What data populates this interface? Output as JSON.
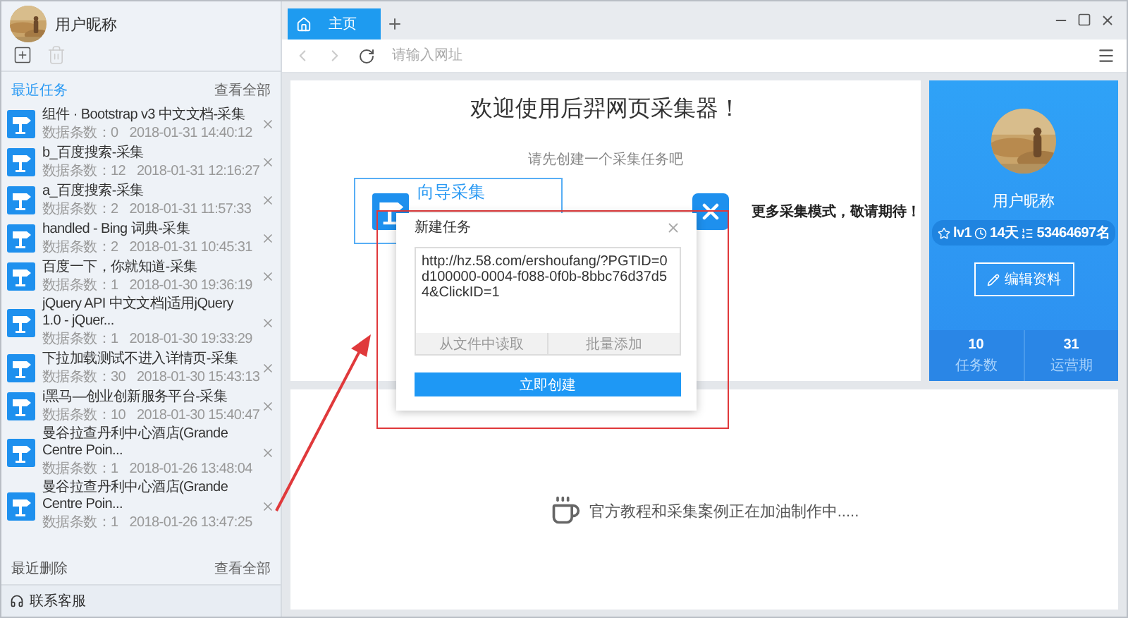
{
  "user": {
    "nickname": "用户昵称"
  },
  "sidebar": {
    "recent_title": "最近任务",
    "recent_link": "查看全部",
    "tasks": [
      {
        "title": "组件 · Bootstrap v3 中文文档-采集",
        "count": "数据条数：0",
        "time": "2018-01-31 14:40:12"
      },
      {
        "title": "b_百度搜索-采集",
        "count": "数据条数：12",
        "time": "2018-01-31 12:16:27"
      },
      {
        "title": "a_百度搜索-采集",
        "count": "数据条数：2",
        "time": "2018-01-31 11:57:33"
      },
      {
        "title": "handled - Bing 词典-采集",
        "count": "数据条数：2",
        "time": "2018-01-31 10:45:31"
      },
      {
        "title": "百度一下，你就知道-采集",
        "count": "数据条数：1",
        "time": "2018-01-30 19:36:19"
      },
      {
        "title": "jQuery API 中文文档|适用jQuery 1.0 - jQuer...",
        "count": "数据条数：1",
        "time": "2018-01-30 19:33:29"
      },
      {
        "title": "下拉加载测试不进入详情页-采集",
        "count": "数据条数：30",
        "time": "2018-01-30 15:43:13"
      },
      {
        "title": "i黑马—创业创新服务平台-采集",
        "count": "数据条数：10",
        "time": "2018-01-30 15:40:47"
      },
      {
        "title": "曼谷拉查丹利中心酒店(Grande Centre Poin...",
        "count": "数据条数：1",
        "time": "2018-01-26 13:48:04"
      },
      {
        "title": "曼谷拉查丹利中心酒店(Grande Centre Poin...",
        "count": "数据条数：1",
        "time": "2018-01-26 13:47:25"
      }
    ],
    "deleted_title": "最近删除",
    "deleted_link": "查看全部",
    "support": "联系客服"
  },
  "tabs": [
    {
      "label": "主页",
      "selected": true
    }
  ],
  "address_bar": {
    "placeholder": "请输入网址"
  },
  "welcome": {
    "title": "欢迎使用后羿网页采集器！",
    "subtitle": "请先创建一个采集任务吧",
    "wizard": "向导采集",
    "more": "更多采集模式，敬请期待！"
  },
  "dialog": {
    "title": "新建任务",
    "url": "http://hz.58.com/ershoufang/?PGTID=0d100000-0004-f088-0f0b-8bbc76d37d54&ClickID=1",
    "actions": [
      "从文件中读取",
      "批量添加"
    ],
    "submit": "立即创建"
  },
  "profile": {
    "nickname": "用户昵称",
    "level": "lv1",
    "days": "14天",
    "rank": "53464697名",
    "edit": "编辑资料",
    "stats": [
      {
        "value": "10",
        "label": "任务数"
      },
      {
        "value": "31",
        "label": "运营期"
      }
    ]
  },
  "tutorial": {
    "message": "官方教程和采集案例正在加油制作中....."
  }
}
